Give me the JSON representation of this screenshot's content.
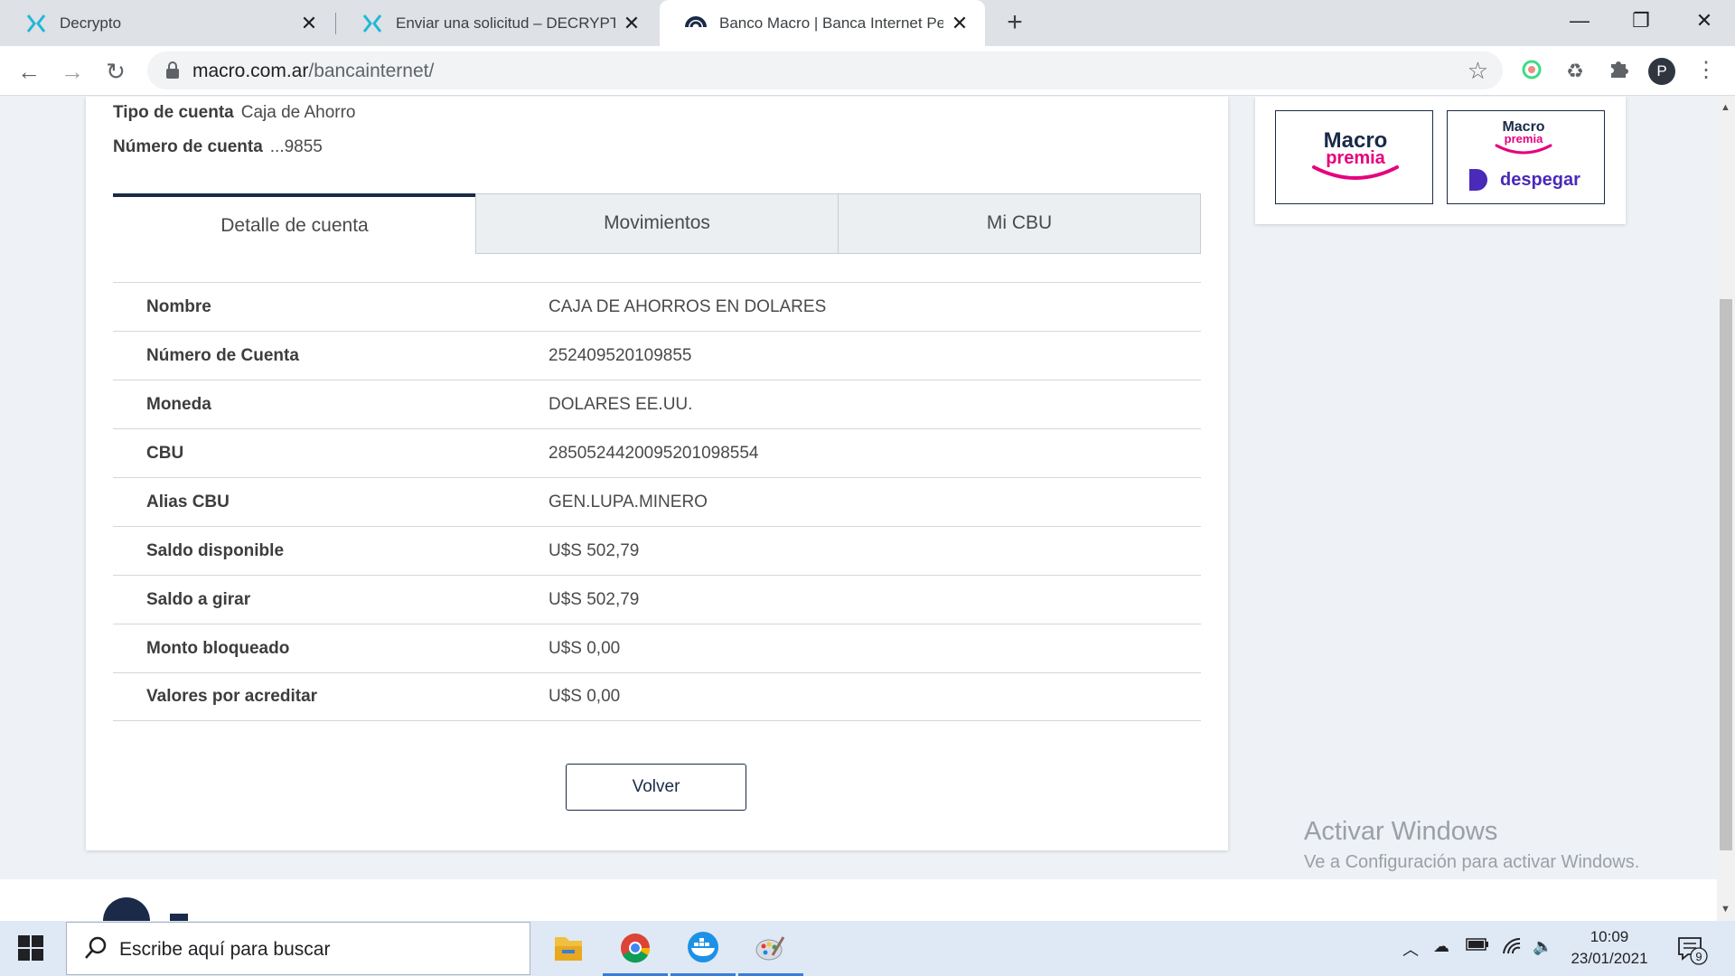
{
  "browser": {
    "tabs": [
      {
        "title": "Decrypto"
      },
      {
        "title": "Enviar una solicitud – DECRYPTO"
      },
      {
        "title": "Banco Macro | Banca Internet Personas"
      }
    ],
    "url_host": "macro.com.ar",
    "url_path": "/bancainternet/",
    "profile_initial": "P"
  },
  "account": {
    "type_label": "Tipo de cuenta",
    "type_value": "Caja de Ahorro",
    "number_label": "Número de cuenta",
    "number_value": "...9855"
  },
  "page_tabs": [
    {
      "label": "Detalle de cuenta",
      "active": true
    },
    {
      "label": "Movimientos",
      "active": false
    },
    {
      "label": "Mi CBU",
      "active": false
    }
  ],
  "details": [
    {
      "label": "Nombre",
      "value": "CAJA DE AHORROS EN DOLARES"
    },
    {
      "label": "Número de Cuenta",
      "value": "252409520109855"
    },
    {
      "label": "Moneda",
      "value": "DOLARES EE.UU."
    },
    {
      "label": "CBU",
      "value": "2850524420095201098554"
    },
    {
      "label": "Alias CBU",
      "value": "GEN.LUPA.MINERO"
    },
    {
      "label": "Saldo disponible",
      "value": "U$S 502,79"
    },
    {
      "label": "Saldo a girar",
      "value": "U$S 502,79"
    },
    {
      "label": "Monto bloqueado",
      "value": "U$S 0,00"
    },
    {
      "label": "Valores por acreditar",
      "value": "U$S 0,00"
    }
  ],
  "back_button": "Volver",
  "promos": {
    "promo1_line1": "Macro",
    "promo1_line2": "premia",
    "promo2_line1": "Macro",
    "promo2_line2": "premia",
    "promo2_brand": "despegar"
  },
  "watermark": {
    "title": "Activar Windows",
    "subtitle": "Ve a Configuración para activar Windows."
  },
  "taskbar": {
    "search_placeholder": "Escribe aquí para buscar",
    "time": "10:09",
    "date": "23/01/2021",
    "notification_count": "9"
  },
  "colors": {
    "brand_navy": "#1a2a48",
    "macro_pink": "#e6007e",
    "despegar_purple": "#4a2ab8",
    "decrypto_teal": "#1fb8d8"
  }
}
